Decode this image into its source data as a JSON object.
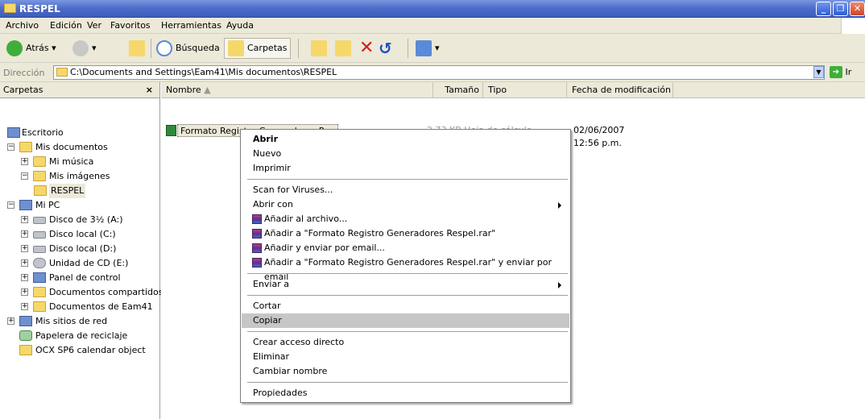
{
  "window": {
    "title": "RESPEL"
  },
  "menubar": [
    "Archivo",
    "Edición",
    "Ver",
    "Favoritos",
    "Herramientas",
    "Ayuda"
  ],
  "toolbar": {
    "back": "Atrás",
    "search": "Búsqueda",
    "folders": "Carpetas"
  },
  "address": {
    "label": "Dirección",
    "path": "C:\\Documents and Settings\\Eam41\\Mis documentos\\RESPEL",
    "go": "Ir"
  },
  "tree": {
    "header": "Carpetas",
    "close": "×",
    "items": [
      "Escritorio",
      "Mis documentos",
      "Mi música",
      "Mis imágenes",
      "RESPEL",
      "Mi PC",
      "Disco de 3½ (A:)",
      "Disco local (C:)",
      "Disco local (D:)",
      "Unidad de CD (E:)",
      "Panel de control",
      "Documentos compartidos",
      "Documentos de Eam41",
      "Mis sitios de red",
      "Papelera de reciclaje",
      "OCX SP6 calendar object"
    ]
  },
  "columns": {
    "name": "Nombre",
    "size": "Tamaño",
    "type": "Tipo",
    "date": "Fecha de modificación"
  },
  "file": {
    "name": "Formato Registro Generadores Respel",
    "rest": "2,73 KB   Hoja de cálculo",
    "date": "02/06/2007 12:56 p.m."
  },
  "context_menu": [
    "Abrir",
    "Nuevo",
    "Imprimir",
    "Scan for Viruses...",
    "Abrir con",
    "Añadir al archivo...",
    "Añadir a \"Formato Registro Generadores Respel.rar\"",
    "Añadir y enviar por email...",
    "Añadir a \"Formato Registro Generadores Respel.rar\" y enviar por email",
    "Enviar a",
    "Cortar",
    "Copiar",
    "Crear acceso directo",
    "Eliminar",
    "Cambiar nombre",
    "Propiedades"
  ]
}
